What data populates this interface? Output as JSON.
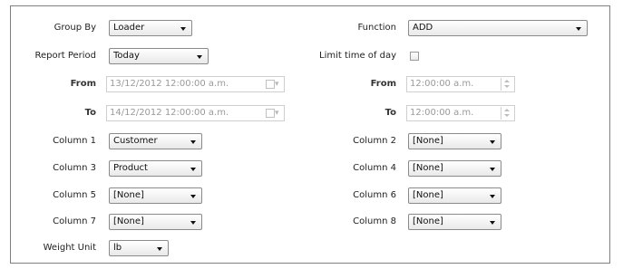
{
  "labels": {
    "group_by": "Group By",
    "report_period": "Report Period",
    "from": "From",
    "to": "To",
    "column_1": "Column 1",
    "column_3": "Column 3",
    "column_5": "Column 5",
    "column_7": "Column 7",
    "weight_unit": "Weight Unit",
    "function": "Function",
    "limit_time": "Limit time of day",
    "from_time": "From",
    "to_time": "To",
    "column_2": "Column 2",
    "column_4": "Column 4",
    "column_6": "Column 6",
    "column_8": "Column 8"
  },
  "values": {
    "group_by": "Loader",
    "report_period": "Today",
    "from_date": "13/12/2012 12:00:00 a.m.",
    "to_date": "14/12/2012 12:00:00 a.m.",
    "column_1": "Customer",
    "column_3": "Product",
    "column_5": "[None]",
    "column_7": "[None]",
    "weight_unit": "lb",
    "function": "ADD",
    "from_time": "12:00:00 a.m.",
    "to_time": "12:00:00 a.m.",
    "column_2": "[None]",
    "column_4": "[None]",
    "column_6": "[None]",
    "column_8": "[None]"
  },
  "limit_time_checked": false,
  "icons": {
    "dropdown": "chevron-down-icon",
    "calendar": "calendar-icon",
    "spinner": "spinner-icon"
  }
}
